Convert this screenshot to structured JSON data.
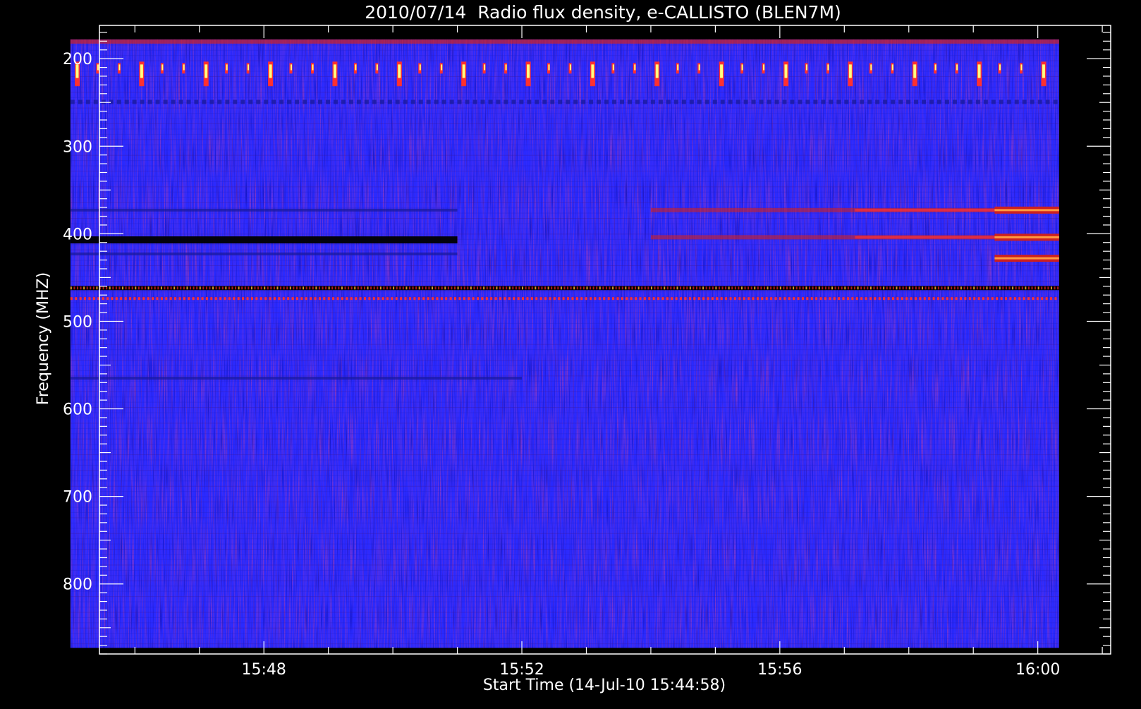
{
  "chart_data": {
    "type": "heatmap",
    "title": "2010/07/14  Radio flux density, e-CALLISTO (BLEN7M)",
    "xlabel": "Start Time (14-Jul-10 15:44:58)",
    "ylabel": "Frequency (MHZ)",
    "x_axis": {
      "unit": "minutes after 15:00",
      "range": [
        45.45,
        61.13
      ],
      "ticks": [
        {
          "value": 48,
          "label": "15:48"
        },
        {
          "value": 52,
          "label": "15:52"
        },
        {
          "value": 56,
          "label": "15:56"
        },
        {
          "value": 60,
          "label": "16:00"
        }
      ],
      "data_range": [
        45.0,
        60.33
      ]
    },
    "y_axis": {
      "unit": "MHz",
      "inverted": true,
      "range": [
        162,
        880
      ],
      "ticks": [
        200,
        300,
        400,
        500,
        600,
        700,
        800
      ],
      "data_range": [
        178,
        873
      ]
    },
    "colormap": [
      "#000000",
      "#1a1a9e",
      "#2a2aff",
      "#cc2020",
      "#ff3030",
      "#ffff80"
    ],
    "background_level": "blue",
    "features": [
      {
        "kind": "periodic_bursts",
        "freq_range": [
          205,
          225
        ],
        "level": "high"
      },
      {
        "kind": "dark_band",
        "freq": 373,
        "time_range": [
          45.0,
          51.0
        ],
        "level": "low"
      },
      {
        "kind": "dark_band",
        "freq": 407,
        "time_range": [
          45.0,
          51.0
        ],
        "level": "very low"
      },
      {
        "kind": "dark_band",
        "freq": 423,
        "time_range": [
          45.0,
          51.0
        ],
        "level": "low"
      },
      {
        "kind": "red_band",
        "freq": 373,
        "time_range": [
          54.0,
          60.33
        ],
        "level": "medium"
      },
      {
        "kind": "red_band",
        "freq": 404,
        "time_range": [
          54.0,
          60.33
        ],
        "level": "medium"
      },
      {
        "kind": "bright_band",
        "freq": 373,
        "time_range": [
          59.33,
          60.33
        ],
        "level": "high"
      },
      {
        "kind": "bright_band",
        "freq": 404,
        "time_range": [
          59.33,
          60.33
        ],
        "level": "high"
      },
      {
        "kind": "bright_band",
        "freq": 428,
        "time_range": [
          59.33,
          60.33
        ],
        "level": "high"
      },
      {
        "kind": "interference_line",
        "freq": 462,
        "time_range": [
          45.0,
          60.33
        ],
        "level": "mixed"
      },
      {
        "kind": "dotted_line",
        "freq": 474,
        "time_range": [
          45.0,
          60.33
        ],
        "level": "red"
      },
      {
        "kind": "dark_band",
        "freq": 565,
        "time_range": [
          45.0,
          52.0
        ],
        "level": "low"
      }
    ]
  }
}
